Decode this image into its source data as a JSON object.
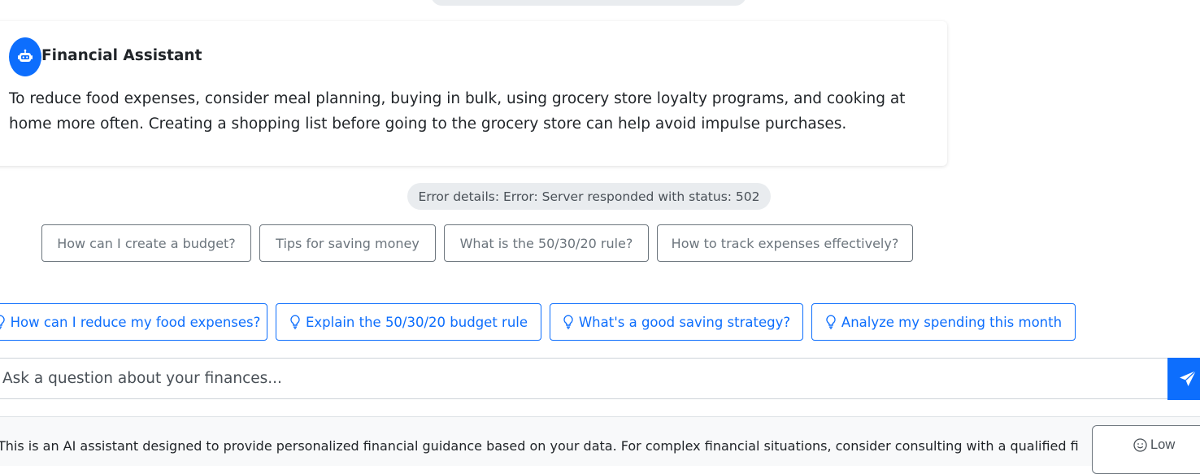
{
  "assistant_card": {
    "title": "Financial Assistant",
    "message": "To reduce food expenses, consider meal planning, buying in bulk, using grocery store loyalty programs, and cooking at home more often. Creating a shopping list before going to the grocery store can help avoid impulse purchases."
  },
  "error": {
    "text": "Error details: Error: Server responded with status: 502"
  },
  "suggestions": [
    {
      "label": "How can I create a budget?"
    },
    {
      "label": "Tips for saving money"
    },
    {
      "label": "What is the 50/30/20 rule?"
    },
    {
      "label": "How to track expenses effectively?"
    }
  ],
  "quick_questions": [
    {
      "label": "How can I reduce my food expenses?",
      "icon": "lightbulb-icon"
    },
    {
      "label": "Explain the 50/30/20 budget rule",
      "icon": "lightbulb-icon"
    },
    {
      "label": "What's a good saving strategy?",
      "icon": "lightbulb-icon"
    },
    {
      "label": "Analyze my spending this month",
      "icon": "lightbulb-icon"
    }
  ],
  "input": {
    "placeholder": "Ask a question about your finances...",
    "send_icon": "send-icon"
  },
  "footer": {
    "disclaimer": "This is an AI assistant designed to provide personalized financial guidance based on your data. For complex financial situations, consider consulting with a qualified financial",
    "mood_label": "Low",
    "mood_icon": "smile-icon"
  },
  "colors": {
    "primary": "#0d6efd",
    "secondary": "#6c757d",
    "pill_bg": "#e9ecef",
    "footer_bg": "#f8f9fa"
  }
}
